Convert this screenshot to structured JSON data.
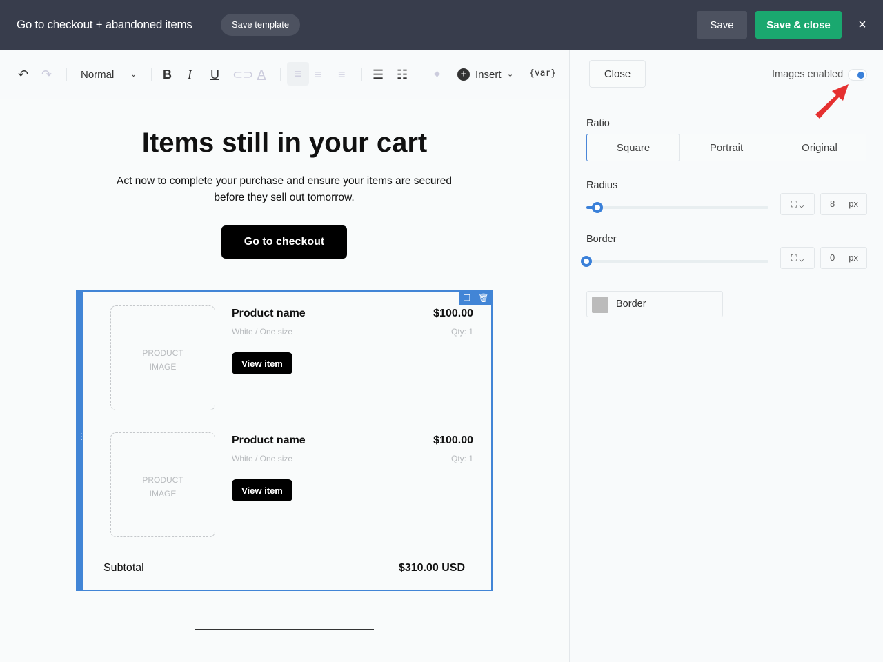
{
  "header": {
    "title": "Go to checkout + abandoned items",
    "save_template": "Save template",
    "save": "Save",
    "save_close": "Save & close",
    "close_icon": "×"
  },
  "toolbar": {
    "style": "Normal",
    "insert": "Insert",
    "var": "{var}"
  },
  "email": {
    "heading": "Items still in your cart",
    "subtext": "Act now to complete your purchase and ensure your items are secured before they sell out tomorrow.",
    "cta": "Go to checkout",
    "items": [
      {
        "image_placeholder_1": "PRODUCT",
        "image_placeholder_2": "IMAGE",
        "name": "Product name",
        "price": "$100.00",
        "variant": "White / One size",
        "qty": "Qty: 1",
        "button": "View item"
      },
      {
        "image_placeholder_1": "PRODUCT",
        "image_placeholder_2": "IMAGE",
        "name": "Product name",
        "price": "$100.00",
        "variant": "White / One size",
        "qty": "Qty: 1",
        "button": "View item"
      }
    ],
    "subtotal_label": "Subtotal",
    "subtotal_value": "$310.00 USD"
  },
  "panel": {
    "close": "Close",
    "images_enabled": "Images enabled",
    "images_enabled_on": true,
    "ratio_label": "Ratio",
    "ratio_options": [
      "Square",
      "Portrait",
      "Original"
    ],
    "ratio_selected": "Square",
    "radius_label": "Radius",
    "radius_value": "8",
    "radius_unit": "px",
    "radius_slider_fraction": 0.06,
    "border_label": "Border",
    "border_value": "0",
    "border_unit": "px",
    "border_slider_fraction": 0,
    "border_color_label": "Border",
    "border_color": "#bbbbbb"
  },
  "colors": {
    "accent": "#3a80d9",
    "save_close": "#1aa86f",
    "header": "#383d4c"
  }
}
